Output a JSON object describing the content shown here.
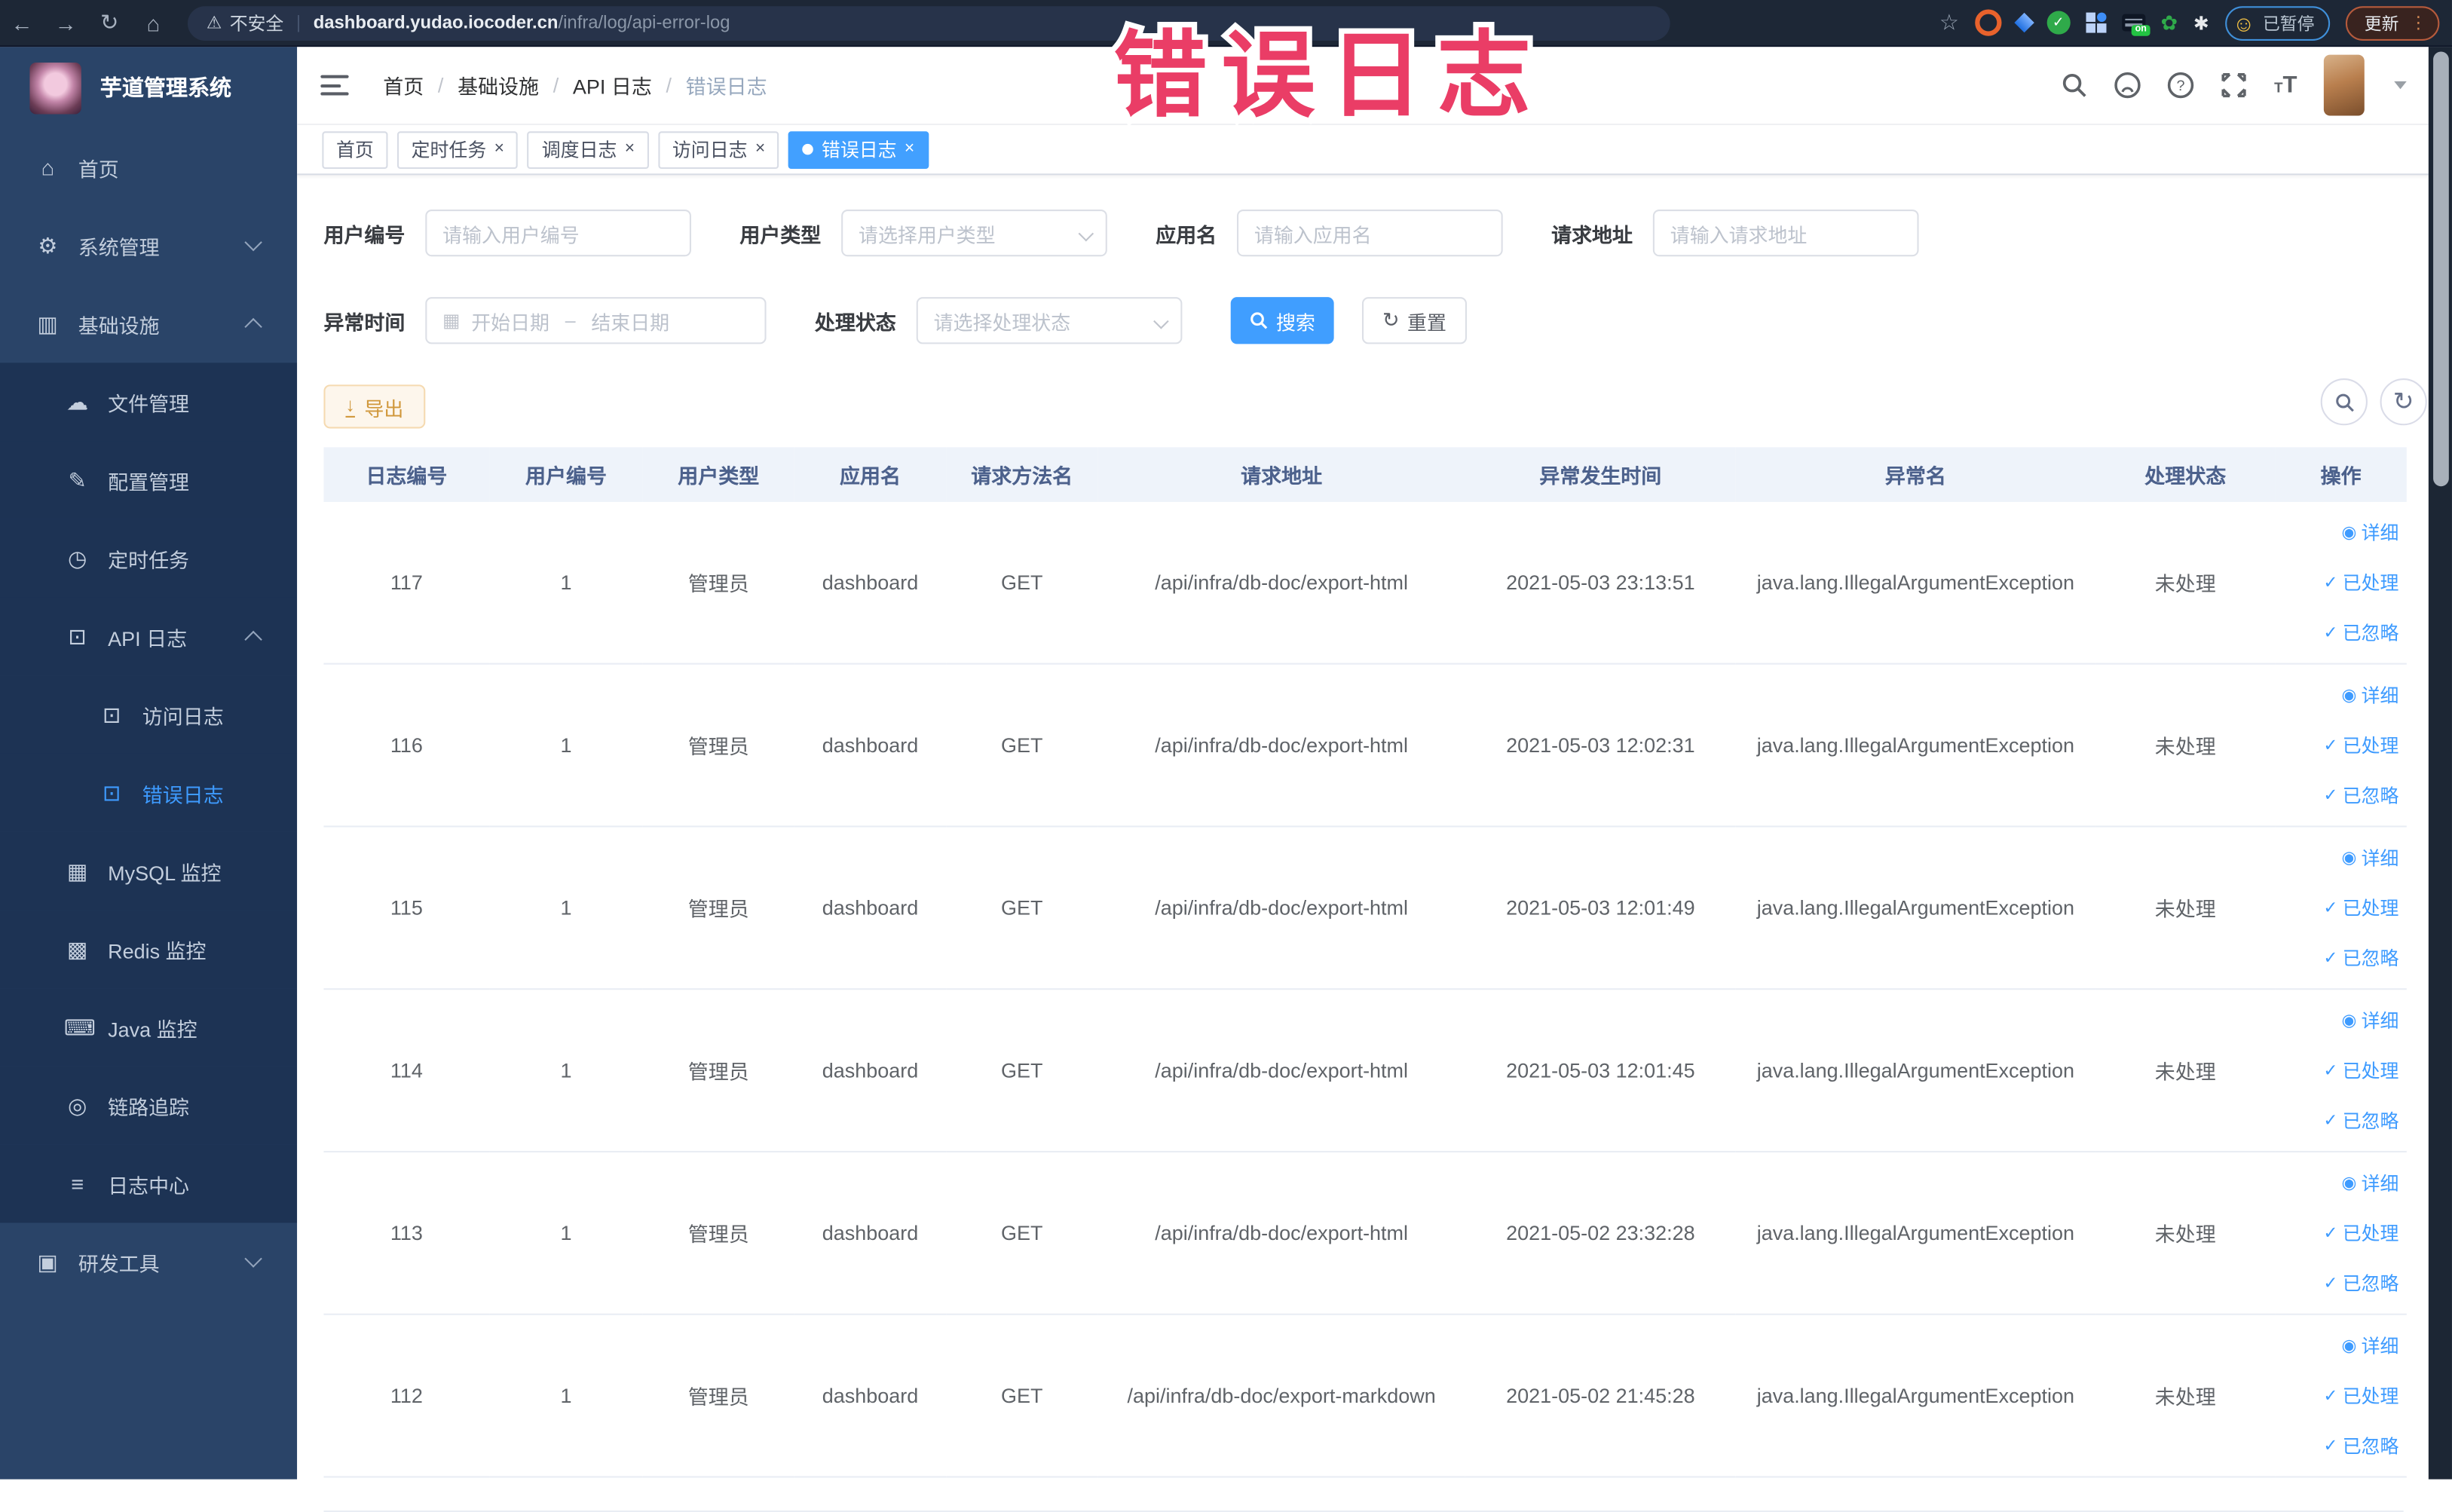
{
  "browser": {
    "security_label": "不安全",
    "url_host": "dashboard.yudao.iocoder.cn",
    "url_path": "/infra/log/api-error-log",
    "ext_on_badge": "on",
    "paused_badge_label": "已暂停",
    "update_button_label": "更新"
  },
  "overlay_title": "错误日志",
  "colors": {
    "accent_blue": "#409eff",
    "warning_orange": "#e6a23c",
    "overlay_pink": "#ea3d66",
    "sidebar_bg": "#2a4468",
    "sidebar_submenu_bg": "#1d3354"
  },
  "sidebar": {
    "app_title": "芋道管理系统",
    "items": [
      {
        "id": "home",
        "label": "首页",
        "icon": "home-icon",
        "level": 1
      },
      {
        "id": "system-manage",
        "label": "系统管理",
        "icon": "gear-icon",
        "level": 1,
        "arrow": "down"
      },
      {
        "id": "infrastructure",
        "label": "基础设施",
        "icon": "infrastructure-icon",
        "level": 1,
        "arrow": "up"
      },
      {
        "id": "file-manage",
        "label": "文件管理",
        "icon": "file-manage-icon",
        "level": 2,
        "dark": true
      },
      {
        "id": "config-manage",
        "label": "配置管理",
        "icon": "config-icon",
        "level": 2,
        "dark": true
      },
      {
        "id": "cron-job",
        "label": "定时任务",
        "icon": "cron-icon",
        "level": 2,
        "dark": true
      },
      {
        "id": "api-log",
        "label": "API 日志",
        "icon": "api-log-icon",
        "level": 2,
        "dark": true,
        "arrow": "up"
      },
      {
        "id": "access-log",
        "label": "访问日志",
        "icon": "access-log-icon",
        "level": 3,
        "dark": true
      },
      {
        "id": "error-log",
        "label": "错误日志",
        "icon": "error-log-icon",
        "level": 3,
        "dark": true,
        "active": true
      },
      {
        "id": "mysql-monitor",
        "label": "MySQL 监控",
        "icon": "mysql-icon",
        "level": 2,
        "dark": true
      },
      {
        "id": "redis-monitor",
        "label": "Redis 监控",
        "icon": "redis-icon",
        "level": 2,
        "dark": true
      },
      {
        "id": "java-monitor",
        "label": "Java 监控",
        "icon": "java-icon",
        "level": 2,
        "dark": true
      },
      {
        "id": "trace",
        "label": "链路追踪",
        "icon": "trace-icon",
        "level": 2,
        "dark": true
      },
      {
        "id": "log-center",
        "label": "日志中心",
        "icon": "log-center-icon",
        "level": 2,
        "dark": true
      },
      {
        "id": "dev-tools",
        "label": "研发工具",
        "icon": "devtools-icon",
        "level": 1,
        "arrow": "down"
      }
    ]
  },
  "navbar": {
    "breadcrumb": [
      "首页",
      "基础设施",
      "API 日志",
      "错误日志"
    ]
  },
  "tabs": [
    {
      "label": "首页",
      "closable": false,
      "active": false
    },
    {
      "label": "定时任务",
      "closable": true,
      "active": false
    },
    {
      "label": "调度日志",
      "closable": true,
      "active": false
    },
    {
      "label": "访问日志",
      "closable": true,
      "active": false
    },
    {
      "label": "错误日志",
      "closable": true,
      "active": true
    }
  ],
  "filters": {
    "user_id": {
      "label": "用户编号",
      "placeholder": "请输入用户编号"
    },
    "user_type": {
      "label": "用户类型",
      "placeholder": "请选择用户类型"
    },
    "app_name": {
      "label": "应用名",
      "placeholder": "请输入应用名"
    },
    "request_url": {
      "label": "请求地址",
      "placeholder": "请输入请求地址"
    },
    "exception_time": {
      "label": "异常时间",
      "start_placeholder": "开始日期",
      "separator": "–",
      "end_placeholder": "结束日期"
    },
    "process_status": {
      "label": "处理状态",
      "placeholder": "请选择处理状态"
    },
    "search_label": "搜索",
    "reset_label": "重置"
  },
  "toolbar": {
    "export_label": "导出"
  },
  "table": {
    "columns": [
      "日志编号",
      "用户编号",
      "用户类型",
      "应用名",
      "请求方法名",
      "请求地址",
      "异常发生时间",
      "异常名",
      "处理状态",
      "操作"
    ],
    "row_actions": [
      "详细",
      "已处理",
      "已忽略"
    ],
    "rows": [
      {
        "id": "117",
        "user_id": "1",
        "user_type": "管理员",
        "app": "dashboard",
        "method": "GET",
        "url": "/api/infra/db-doc/export-html",
        "time": "2021-05-03 23:13:51",
        "exception": "java.lang.IllegalArgumentException",
        "status": "未处理"
      },
      {
        "id": "116",
        "user_id": "1",
        "user_type": "管理员",
        "app": "dashboard",
        "method": "GET",
        "url": "/api/infra/db-doc/export-html",
        "time": "2021-05-03 12:02:31",
        "exception": "java.lang.IllegalArgumentException",
        "status": "未处理"
      },
      {
        "id": "115",
        "user_id": "1",
        "user_type": "管理员",
        "app": "dashboard",
        "method": "GET",
        "url": "/api/infra/db-doc/export-html",
        "time": "2021-05-03 12:01:49",
        "exception": "java.lang.IllegalArgumentException",
        "status": "未处理"
      },
      {
        "id": "114",
        "user_id": "1",
        "user_type": "管理员",
        "app": "dashboard",
        "method": "GET",
        "url": "/api/infra/db-doc/export-html",
        "time": "2021-05-03 12:01:45",
        "exception": "java.lang.IllegalArgumentException",
        "status": "未处理"
      },
      {
        "id": "113",
        "user_id": "1",
        "user_type": "管理员",
        "app": "dashboard",
        "method": "GET",
        "url": "/api/infra/db-doc/export-html",
        "time": "2021-05-02 23:32:28",
        "exception": "java.lang.IllegalArgumentException",
        "status": "未处理"
      },
      {
        "id": "112",
        "user_id": "1",
        "user_type": "管理员",
        "app": "dashboard",
        "method": "GET",
        "url": "/api/infra/db-doc/export-markdown",
        "time": "2021-05-02 21:45:28",
        "exception": "java.lang.IllegalArgumentException",
        "status": "未处理"
      }
    ]
  }
}
